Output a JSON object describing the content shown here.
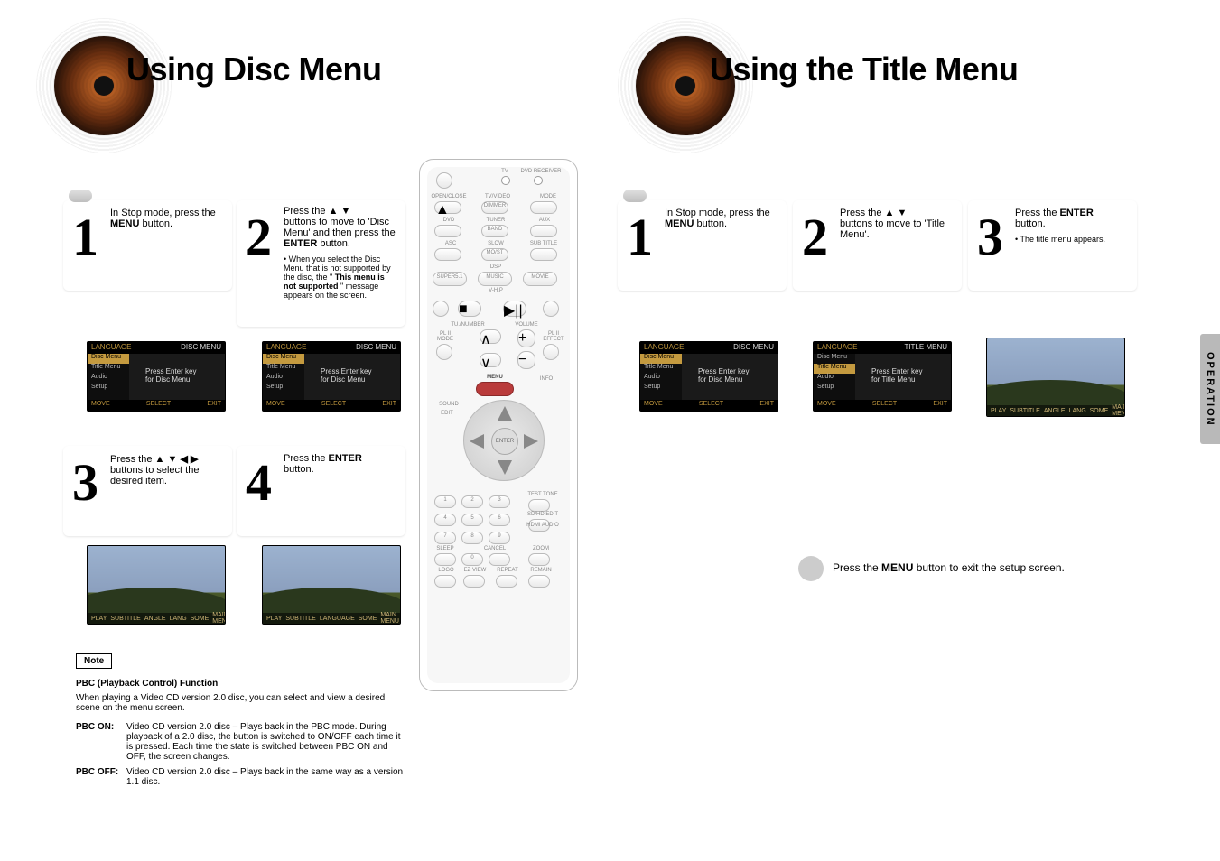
{
  "left": {
    "heading": "Using Disc Menu",
    "steps": {
      "s1": {
        "num": "1",
        "line1": "In Stop mode, press the",
        "key": "MENU",
        "line2": "button."
      },
      "s2": {
        "num": "2",
        "line1": "Press the",
        "arrows": "▲ ▼",
        "line2a": "buttons to move to 'Disc Menu' and then press the",
        "key": "ENTER",
        "line2b": "button.",
        "sub1": "When you select the Disc Menu that is not supported by the disc, the \"",
        "submsg": "This menu is not supported",
        "sub2": "\" message appears on the screen."
      },
      "s3": {
        "num": "3",
        "arrows1": "▲ ▼",
        "line1": "Press the",
        "arrows2": "◀ ▶",
        "line2": "buttons to select the desired item."
      },
      "s4": {
        "num": "4",
        "line1": "Press the",
        "key": "ENTER",
        "line2": "button."
      }
    },
    "shot": {
      "hdr_l": "LANGUAGE",
      "hdr_r": "DISC MENU",
      "menu_items": [
        "Disc Menu",
        "Title Menu",
        "Audio",
        "Setup"
      ],
      "center1": "Press Enter key",
      "center2": "for Disc Menu",
      "bot_l": "MOVE",
      "bot_m": "SELECT",
      "bot_r": "EXIT"
    },
    "photo_strip_items": [
      "PLAY",
      "SUBTITLE",
      "ANGLE",
      "LANG",
      "SOME",
      "MAIN MENU"
    ],
    "photo_strip_items2": [
      "PLAY",
      "SUBTITLE",
      "LANGUAGE",
      "SOME",
      "MAIN MENU"
    ],
    "note_label": "Note",
    "note_heading": "PBC (Playback Control) Function",
    "note_intro": "When playing a Video CD version 2.0 disc, you can select and view a desired scene on the menu screen.",
    "note_on_label": "PBC ON:",
    "note_on": "Video CD version 2.0 disc – Plays back in the PBC mode. During playback of a 2.0 disc, the button is switched to ON/OFF each time it is pressed. Each time the state is switched between PBC ON and OFF, the screen changes.",
    "note_off_label": "PBC OFF:",
    "note_off": "Video CD version 2.0 disc – Plays back in the same way as a version 1.1 disc."
  },
  "right": {
    "heading": "Using the Title Menu",
    "tab": "OPERATION",
    "steps": {
      "s1": {
        "num": "1",
        "line1": "In Stop mode, press the",
        "key": "MENU",
        "line2": "button."
      },
      "s2": {
        "num": "2",
        "line1": "Press the",
        "arrows": "▲ ▼",
        "line2": "buttons to move to 'Title Menu'."
      },
      "s3": {
        "num": "3",
        "line1": "Press the",
        "key": "ENTER",
        "line2": "button.",
        "sub": "The title menu appears."
      }
    },
    "shot_disc": {
      "hdr_l": "LANGUAGE",
      "hdr_r": "DISC MENU",
      "center1": "Press Enter key",
      "center2": "for Disc Menu"
    },
    "shot_title": {
      "hdr_l": "LANGUAGE",
      "hdr_r": "TITLE MENU",
      "center1": "Press Enter key",
      "center2": "for Title Menu"
    },
    "menu_items": [
      "Disc Menu",
      "Title Menu",
      "Audio",
      "Setup"
    ],
    "bot_l": "MOVE",
    "bot_m": "SELECT",
    "bot_r": "EXIT",
    "closing_pre": "Press the",
    "closing_key": "MENU",
    "closing_post": "button to exit the setup screen."
  },
  "remote": {
    "labels": {
      "tv": "TV",
      "dvdrcv": "DVD RECEIVER",
      "opencls": "OPEN/CLOSE",
      "tvvideo": "TV/VIDEO",
      "mode": "MODE",
      "dimmer": "DIMMER",
      "dvd": "DVD",
      "tuner": "TUNER",
      "band": "BAND",
      "aux": "AUX",
      "asc": "ASC",
      "slow": "SLOW",
      "mo_st": "MO/ST",
      "subtitle": "SUB TITLE",
      "dsp": "DSP",
      "super5": "SUPER5.1",
      "music": "MUSIC",
      "movie": "MOVIE",
      "vhp": "V-H.P",
      "tn_num": "TU./NUMBER",
      "volume": "VOLUME",
      "plii_mode": "PL II MODE",
      "plii_eff": "PL II EFFECT",
      "menu": "MENU",
      "info": "INFO",
      "sound": "SOUND",
      "edit": "EDIT",
      "enter": "ENTER",
      "testtone": "TEST TONE",
      "sdedit": "SD/HD EDIT",
      "hdmiaudio": "HDMI AUDIO",
      "sleep": "SLEEP",
      "cancel": "CANCEL",
      "zoom": "ZOOM",
      "logo": "LOGO",
      "ezview": "EZ VIEW",
      "repeat": "REPEAT",
      "remain": "REMAIN",
      "n1": "1",
      "n2": "2",
      "n3": "3",
      "n4": "4",
      "n5": "5",
      "n6": "6",
      "n7": "7",
      "n8": "8",
      "n9": "9",
      "n0": "0"
    }
  }
}
